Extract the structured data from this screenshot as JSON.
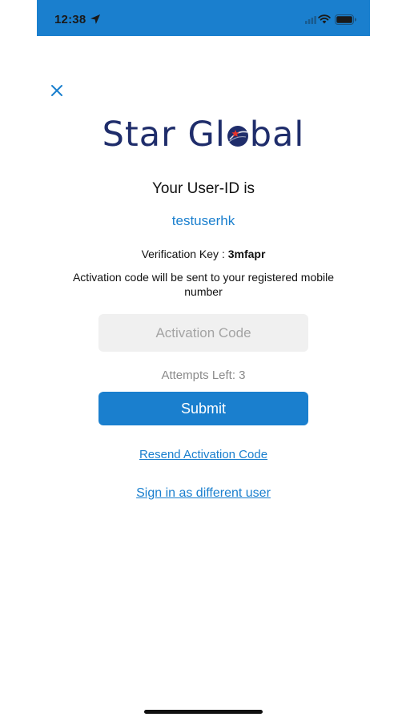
{
  "status_bar": {
    "time": "12:38"
  },
  "header": {
    "close_icon": "close-icon"
  },
  "logo": {
    "text_before": "Star Gl",
    "text_after": "bal",
    "colors": {
      "text": "#1f2d6b",
      "globe": "#1f2d6b",
      "globe_accent": "#e8332a"
    }
  },
  "user": {
    "title": "Your User-ID is",
    "user_id": "testuserhk"
  },
  "verification": {
    "label": "Verification Key : ",
    "key": "3mfapr"
  },
  "activation": {
    "info": "Activation code will be sent to your registered mobile number",
    "placeholder": "Activation Code",
    "value": "",
    "attempts_label": "Attempts Left: 3"
  },
  "actions": {
    "submit_label": "Submit",
    "resend_label": "Resend Activation Code",
    "signin_label": "Sign in as different user"
  },
  "colors": {
    "accent": "#1a7fce",
    "status_bar": "#1a7fce",
    "input_bg": "#f0f0f0"
  }
}
